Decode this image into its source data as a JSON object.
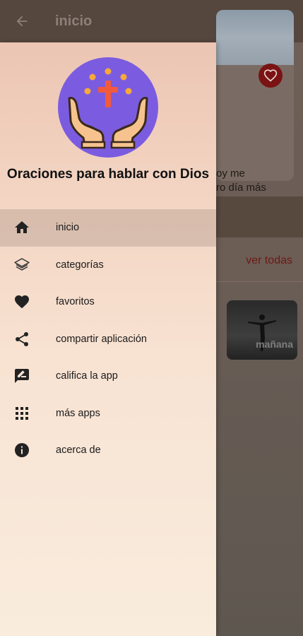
{
  "app_bar": {
    "title": "inicio",
    "back_icon": "arrow-back-icon"
  },
  "background": {
    "card_text_line1": "oy me",
    "card_text_line2": "ro día más",
    "section_link": "ver todas",
    "thumbnail_label": "mañana",
    "heart_color": "#7a1313"
  },
  "drawer": {
    "app_name": "Oraciones para hablar con Dios",
    "logo_colors": {
      "circle": "#7b5ce0",
      "hands": "#f6c38e",
      "cross": "#f15a3c",
      "dots": "#f7a93a"
    },
    "items": [
      {
        "label": "inicio",
        "icon": "home-icon",
        "active": true
      },
      {
        "label": "categorías",
        "icon": "layers-icon",
        "active": false
      },
      {
        "label": "favoritos",
        "icon": "heart-icon",
        "active": false
      },
      {
        "label": "compartir aplicación",
        "icon": "share-icon",
        "active": false
      },
      {
        "label": "califica la app",
        "icon": "rate-review-icon",
        "active": false
      },
      {
        "label": "más apps",
        "icon": "apps-grid-icon",
        "active": false
      },
      {
        "label": "acerca de",
        "icon": "info-icon",
        "active": false
      }
    ]
  }
}
